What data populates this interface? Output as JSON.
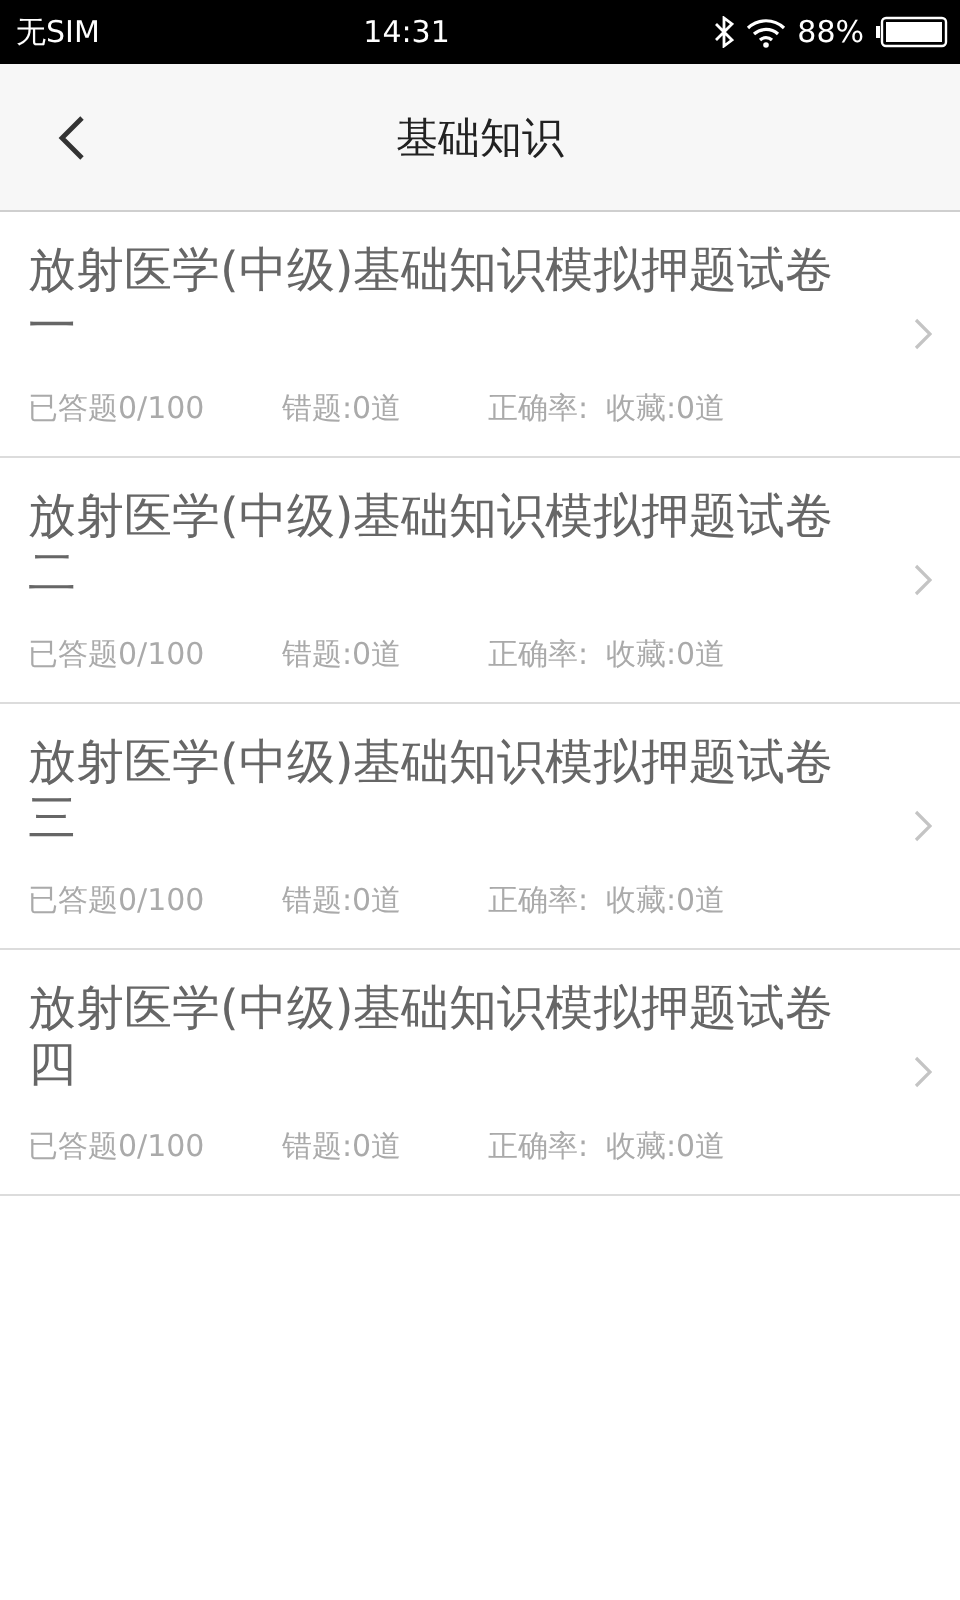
{
  "status_bar": {
    "carrier": "无SIM",
    "time": "14:31",
    "battery": "88%"
  },
  "header": {
    "title": "基础知识"
  },
  "papers": [
    {
      "title": "放射医学(中级)基础知识模拟押题试卷一",
      "answered": "已答题0/100",
      "wrong": "错题:0道",
      "accuracy": "正确率:",
      "favorites": "收藏:0道"
    },
    {
      "title": "放射医学(中级)基础知识模拟押题试卷二",
      "answered": "已答题0/100",
      "wrong": "错题:0道",
      "accuracy": "正确率:",
      "favorites": "收藏:0道"
    },
    {
      "title": "放射医学(中级)基础知识模拟押题试卷三",
      "answered": "已答题0/100",
      "wrong": "错题:0道",
      "accuracy": "正确率:",
      "favorites": "收藏:0道"
    },
    {
      "title": "放射医学(中级)基础知识模拟押题试卷四",
      "answered": "已答题0/100",
      "wrong": "错题:0道",
      "accuracy": "正确率:",
      "favorites": "收藏:0道"
    }
  ]
}
